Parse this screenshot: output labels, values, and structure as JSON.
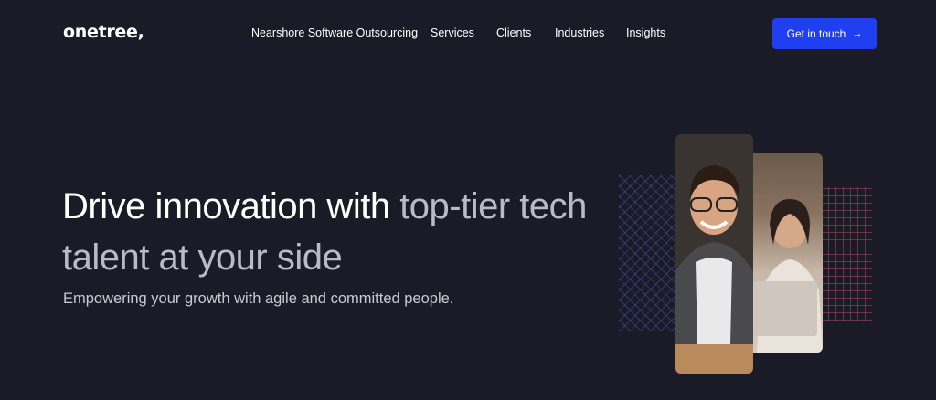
{
  "header": {
    "logo": "onetree,",
    "nav": [
      {
        "label": "Nearshore Software Outsourcing"
      },
      {
        "label": "Services"
      },
      {
        "label": "Clients"
      },
      {
        "label": "Industries"
      },
      {
        "label": "Insights"
      }
    ],
    "cta": {
      "label": "Get in touch",
      "icon": "arrow-right-icon",
      "color": "#1f3ff0"
    }
  },
  "hero": {
    "title_main": "Drive innovation with ",
    "title_highlight": "top-tier tech talent at your side",
    "subtitle": "Empowering your growth with agile and committed people."
  },
  "colors": {
    "background": "#1a1b26",
    "accent": "#1f3ff0"
  }
}
